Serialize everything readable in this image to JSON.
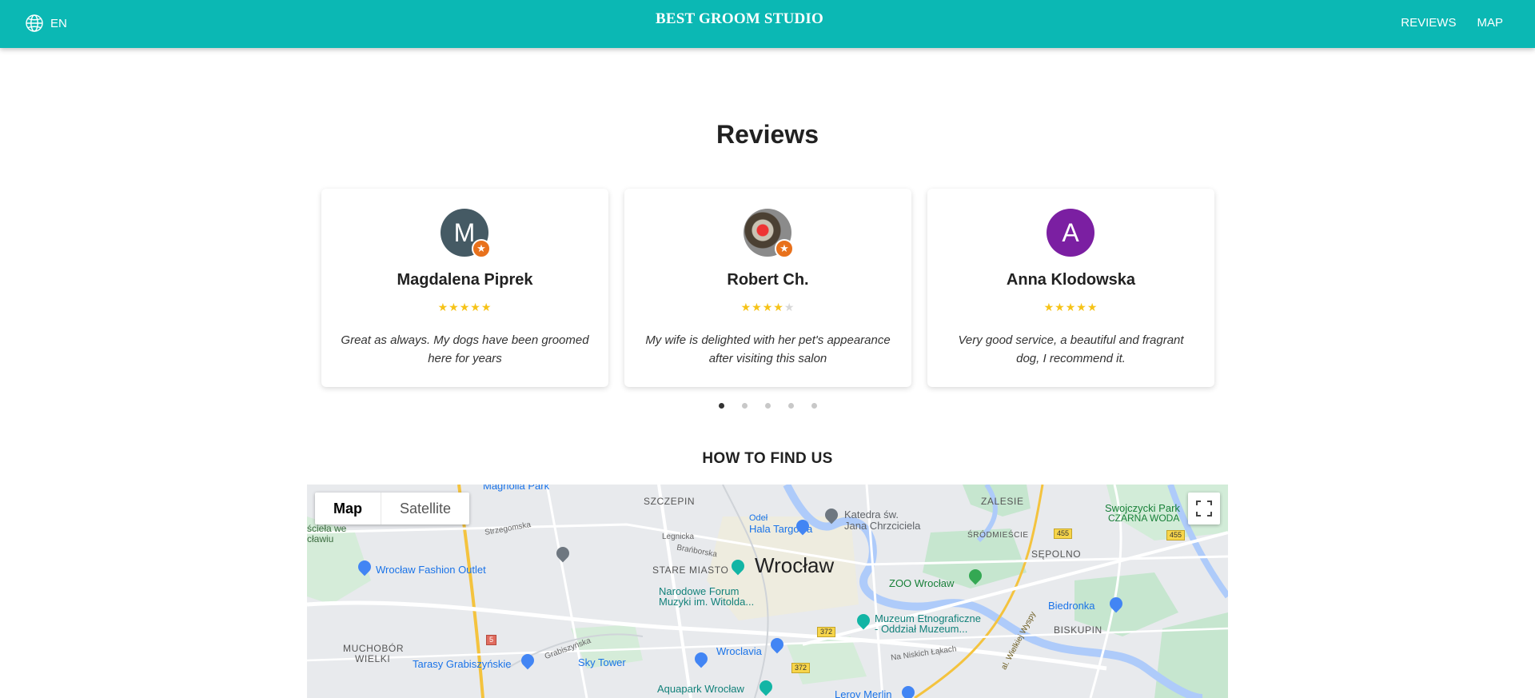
{
  "header": {
    "language": "EN",
    "brand": "BEST GROOM STUDIO",
    "nav": [
      "REVIEWS",
      "MAP"
    ],
    "color": "#0bb8b4"
  },
  "reviews": {
    "title": "Reviews",
    "items": [
      {
        "initial": "M",
        "avatar_color": "#455a64",
        "name": "Magdalena Piprek",
        "rating": 5,
        "text": "Great as always. My dogs have been groomed here for years"
      },
      {
        "initial": "",
        "avatar_color": "photo",
        "name": "Robert Ch.",
        "rating": 4,
        "text": "My wife is delighted with her pet's appearance after visiting this salon"
      },
      {
        "initial": "A",
        "avatar_color": "#7b1fa2",
        "name": "Anna Klodowska",
        "rating": 5,
        "text": "Very good service, a beautiful and fragrant dog, I recommend it."
      }
    ],
    "dots": 5,
    "active_dot": 1
  },
  "find_us": {
    "title": "HOW TO FIND US",
    "map_type": [
      "Map",
      "Satellite"
    ],
    "labels": {
      "city": "Wrocław",
      "szczepin": "SZCZEPIN",
      "stare_miasto": "STARE MIASTO",
      "zalesie": "ZALESIE",
      "srodmiescie": "ŚRÓDMIEŚCIE",
      "sepolno": "SĘPOLNO",
      "biskupin": "BISKUPIN",
      "muchobor1": "MUCHOBÓR",
      "muchobor2": "WIELKI",
      "magnolia": "Magnolia Park",
      "fashion": "Wrocław Fashion Outlet",
      "hala1": "Odeł",
      "hala2": "Hala Targowa",
      "katedra1": "Katedra św.",
      "katedra2": "Jana Chrzciciela",
      "swojczyce1": "Swojczycki Park",
      "swojczyce2": "CZARNA WODA",
      "forum1": "Narodowe Forum",
      "forum2": "Muzyki im. Witolda...",
      "zoo": "ZOO Wrocław",
      "muzeum1": "Muzeum Etnograficzne",
      "muzeum2": "- Oddział Muzeum...",
      "biedronka": "Biedronka",
      "tarasy": "Tarasy Grabiszyńskie",
      "skytower": "Sky Tower",
      "wroclavia": "Wroclavia",
      "aquapark": "Aquapark Wrocław",
      "leroy": "Leroy Merlin",
      "legnicka": "Legnicka",
      "stzegomska": "Strzegomska",
      "branicka": "Brańborska",
      "grabiszynska": "Grabiszyńska",
      "nankich": "Na Niskich Łąkach",
      "road455a": "455",
      "road455b": "455",
      "road372a": "372",
      "road372b": "372",
      "road5": "5",
      "cielawe1": "ścieła we",
      "cielawe2": "cławiu",
      "wielkiej": "al. Wielkiej Wyspy"
    }
  }
}
